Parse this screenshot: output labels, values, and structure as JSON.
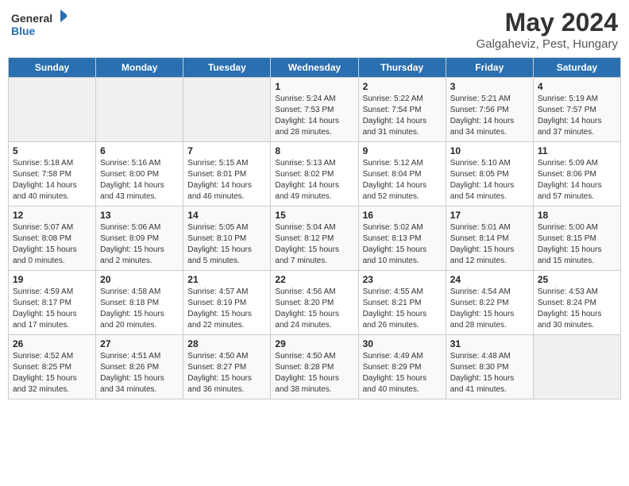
{
  "logo": {
    "line1": "General",
    "line2": "Blue"
  },
  "title": "May 2024",
  "subtitle": "Galgaheviz, Pest, Hungary",
  "days_header": [
    "Sunday",
    "Monday",
    "Tuesday",
    "Wednesday",
    "Thursday",
    "Friday",
    "Saturday"
  ],
  "weeks": [
    [
      {
        "day": "",
        "info": ""
      },
      {
        "day": "",
        "info": ""
      },
      {
        "day": "",
        "info": ""
      },
      {
        "day": "1",
        "info": "Sunrise: 5:24 AM\nSunset: 7:53 PM\nDaylight: 14 hours\nand 28 minutes."
      },
      {
        "day": "2",
        "info": "Sunrise: 5:22 AM\nSunset: 7:54 PM\nDaylight: 14 hours\nand 31 minutes."
      },
      {
        "day": "3",
        "info": "Sunrise: 5:21 AM\nSunset: 7:56 PM\nDaylight: 14 hours\nand 34 minutes."
      },
      {
        "day": "4",
        "info": "Sunrise: 5:19 AM\nSunset: 7:57 PM\nDaylight: 14 hours\nand 37 minutes."
      }
    ],
    [
      {
        "day": "5",
        "info": "Sunrise: 5:18 AM\nSunset: 7:58 PM\nDaylight: 14 hours\nand 40 minutes."
      },
      {
        "day": "6",
        "info": "Sunrise: 5:16 AM\nSunset: 8:00 PM\nDaylight: 14 hours\nand 43 minutes."
      },
      {
        "day": "7",
        "info": "Sunrise: 5:15 AM\nSunset: 8:01 PM\nDaylight: 14 hours\nand 46 minutes."
      },
      {
        "day": "8",
        "info": "Sunrise: 5:13 AM\nSunset: 8:02 PM\nDaylight: 14 hours\nand 49 minutes."
      },
      {
        "day": "9",
        "info": "Sunrise: 5:12 AM\nSunset: 8:04 PM\nDaylight: 14 hours\nand 52 minutes."
      },
      {
        "day": "10",
        "info": "Sunrise: 5:10 AM\nSunset: 8:05 PM\nDaylight: 14 hours\nand 54 minutes."
      },
      {
        "day": "11",
        "info": "Sunrise: 5:09 AM\nSunset: 8:06 PM\nDaylight: 14 hours\nand 57 minutes."
      }
    ],
    [
      {
        "day": "12",
        "info": "Sunrise: 5:07 AM\nSunset: 8:08 PM\nDaylight: 15 hours\nand 0 minutes."
      },
      {
        "day": "13",
        "info": "Sunrise: 5:06 AM\nSunset: 8:09 PM\nDaylight: 15 hours\nand 2 minutes."
      },
      {
        "day": "14",
        "info": "Sunrise: 5:05 AM\nSunset: 8:10 PM\nDaylight: 15 hours\nand 5 minutes."
      },
      {
        "day": "15",
        "info": "Sunrise: 5:04 AM\nSunset: 8:12 PM\nDaylight: 15 hours\nand 7 minutes."
      },
      {
        "day": "16",
        "info": "Sunrise: 5:02 AM\nSunset: 8:13 PM\nDaylight: 15 hours\nand 10 minutes."
      },
      {
        "day": "17",
        "info": "Sunrise: 5:01 AM\nSunset: 8:14 PM\nDaylight: 15 hours\nand 12 minutes."
      },
      {
        "day": "18",
        "info": "Sunrise: 5:00 AM\nSunset: 8:15 PM\nDaylight: 15 hours\nand 15 minutes."
      }
    ],
    [
      {
        "day": "19",
        "info": "Sunrise: 4:59 AM\nSunset: 8:17 PM\nDaylight: 15 hours\nand 17 minutes."
      },
      {
        "day": "20",
        "info": "Sunrise: 4:58 AM\nSunset: 8:18 PM\nDaylight: 15 hours\nand 20 minutes."
      },
      {
        "day": "21",
        "info": "Sunrise: 4:57 AM\nSunset: 8:19 PM\nDaylight: 15 hours\nand 22 minutes."
      },
      {
        "day": "22",
        "info": "Sunrise: 4:56 AM\nSunset: 8:20 PM\nDaylight: 15 hours\nand 24 minutes."
      },
      {
        "day": "23",
        "info": "Sunrise: 4:55 AM\nSunset: 8:21 PM\nDaylight: 15 hours\nand 26 minutes."
      },
      {
        "day": "24",
        "info": "Sunrise: 4:54 AM\nSunset: 8:22 PM\nDaylight: 15 hours\nand 28 minutes."
      },
      {
        "day": "25",
        "info": "Sunrise: 4:53 AM\nSunset: 8:24 PM\nDaylight: 15 hours\nand 30 minutes."
      }
    ],
    [
      {
        "day": "26",
        "info": "Sunrise: 4:52 AM\nSunset: 8:25 PM\nDaylight: 15 hours\nand 32 minutes."
      },
      {
        "day": "27",
        "info": "Sunrise: 4:51 AM\nSunset: 8:26 PM\nDaylight: 15 hours\nand 34 minutes."
      },
      {
        "day": "28",
        "info": "Sunrise: 4:50 AM\nSunset: 8:27 PM\nDaylight: 15 hours\nand 36 minutes."
      },
      {
        "day": "29",
        "info": "Sunrise: 4:50 AM\nSunset: 8:28 PM\nDaylight: 15 hours\nand 38 minutes."
      },
      {
        "day": "30",
        "info": "Sunrise: 4:49 AM\nSunset: 8:29 PM\nDaylight: 15 hours\nand 40 minutes."
      },
      {
        "day": "31",
        "info": "Sunrise: 4:48 AM\nSunset: 8:30 PM\nDaylight: 15 hours\nand 41 minutes."
      },
      {
        "day": "",
        "info": ""
      }
    ]
  ]
}
